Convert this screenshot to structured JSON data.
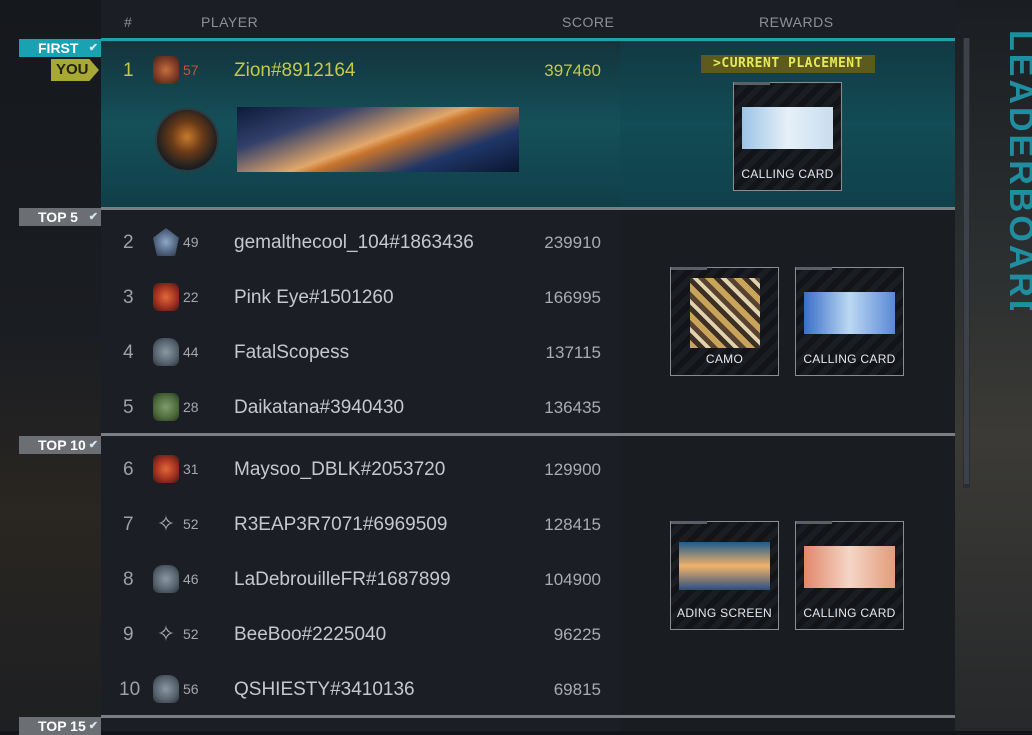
{
  "headers": {
    "rank": "#",
    "player": "PLAYER",
    "score": "SCORE",
    "rewards": "REWARDS"
  },
  "side_title": "LEADERBOARD",
  "tiers": {
    "first": "FIRST",
    "top5": "TOP 5",
    "top10": "TOP 10",
    "top15": "TOP 15"
  },
  "you_tag": "YOU",
  "current_placement": ">CURRENT PLACEMENT",
  "rows": [
    {
      "rank": "1",
      "level": "57",
      "name": "Zion#8912164",
      "score": "397460",
      "emblem": "skull-emblem-red-icon"
    },
    {
      "rank": "2",
      "level": "49",
      "name": "gemalthecool_104#1863436",
      "score": "239910",
      "emblem": "winged-emblem-icon"
    },
    {
      "rank": "3",
      "level": "22",
      "name": "Pink Eye#1501260",
      "score": "166995",
      "emblem": "red-helmet-emblem-icon"
    },
    {
      "rank": "4",
      "level": "44",
      "name": "FatalScopess",
      "score": "137115",
      "emblem": "skull-emblem-icon"
    },
    {
      "rank": "5",
      "level": "28",
      "name": "Daikatana#3940430",
      "score": "136435",
      "emblem": "soldier-emblem-icon"
    },
    {
      "rank": "6",
      "level": "31",
      "name": "Maysoo_DBLK#2053720",
      "score": "129900",
      "emblem": "red-helmet-emblem-icon"
    },
    {
      "rank": "7",
      "level": "52",
      "name": "R3EAP3R7071#6969509",
      "score": "128415",
      "emblem": "star-emblem-icon"
    },
    {
      "rank": "8",
      "level": "46",
      "name": "LaDebrouilleFR#1687899",
      "score": "104900",
      "emblem": "skull-emblem-icon"
    },
    {
      "rank": "9",
      "level": "52",
      "name": "BeeBoo#2225040",
      "score": "96225",
      "emblem": "star-emblem-icon"
    },
    {
      "rank": "10",
      "level": "56",
      "name": "QSHIESTY#3410136",
      "score": "69815",
      "emblem": "skull-emblem-icon"
    }
  ],
  "rewards": {
    "first": [
      {
        "label": "CALLING CARD"
      }
    ],
    "top5": [
      {
        "label": "CAMO"
      },
      {
        "label": "CALLING CARD"
      }
    ],
    "top10": [
      {
        "label": "ADING SCREEN"
      },
      {
        "label": "CALLING CARD"
      }
    ]
  },
  "colors": {
    "accent": "#1aa2b2",
    "you": "#a8a834",
    "highlight_text": "#c5c84a"
  }
}
